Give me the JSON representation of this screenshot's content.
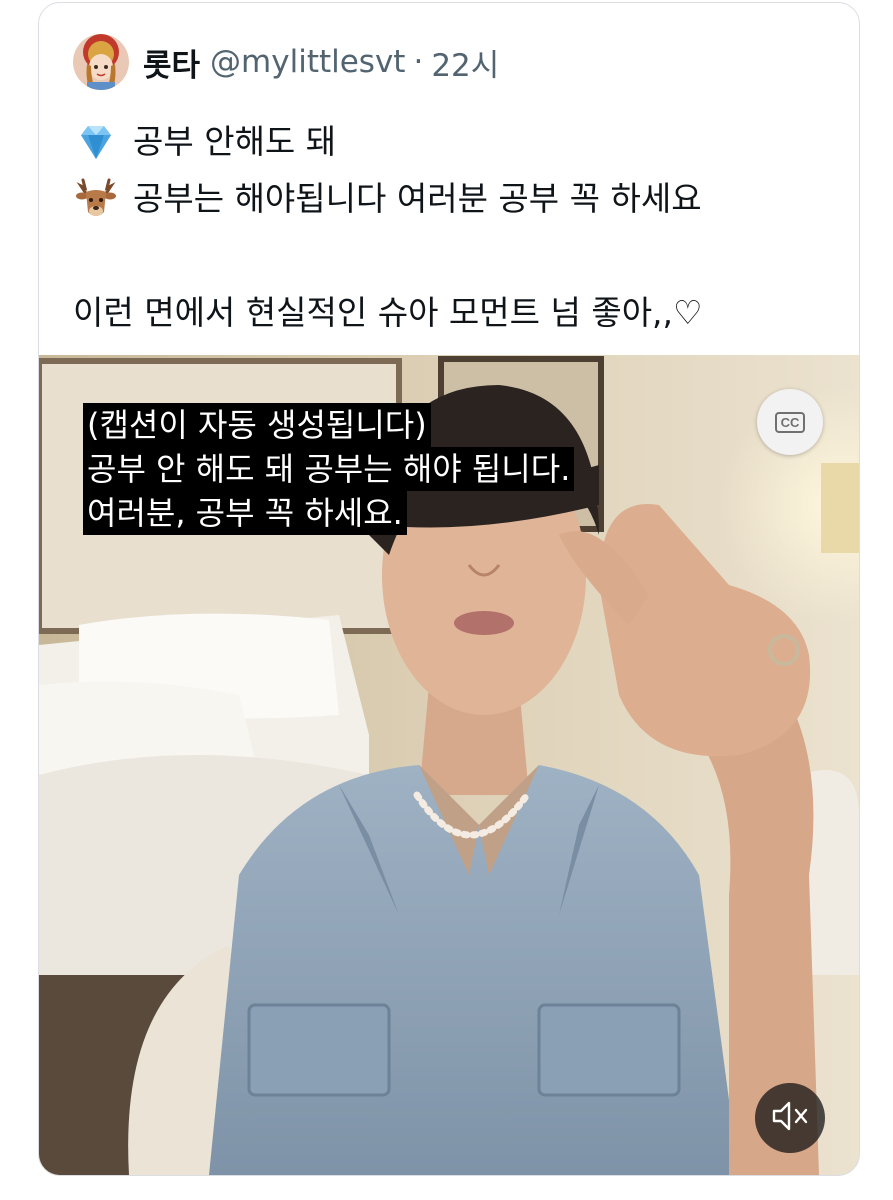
{
  "tweet": {
    "display_name": "롯타",
    "handle": "@mylittlesvt",
    "separator": "·",
    "time": "22시",
    "avatar_icon": "avatar-illustration",
    "lines": [
      {
        "emoji": "diamond-icon",
        "text": "공부 안해도 돼"
      },
      {
        "emoji": "deer-icon",
        "text": "공부는 해야됩니다 여러분 공부 꼭 하세요"
      },
      {
        "emoji": "",
        "text": ""
      },
      {
        "emoji": "",
        "text": "이런 면에서 현실적인 슈아 모먼트 넘 좋아,,♡"
      }
    ]
  },
  "video": {
    "captions": [
      "(캡션이 자동 생성됩니다)",
      "공부 안 해도 돼 공부는 해야 됩니다.",
      "여러분, 공부 꼭 하세요."
    ],
    "cc_label": "CC",
    "mute_icon": "speaker-muted-icon",
    "colors": {
      "wall": "#d8c9b0",
      "bed": "#f2efe9",
      "jacket": "#8fa3b8"
    }
  }
}
